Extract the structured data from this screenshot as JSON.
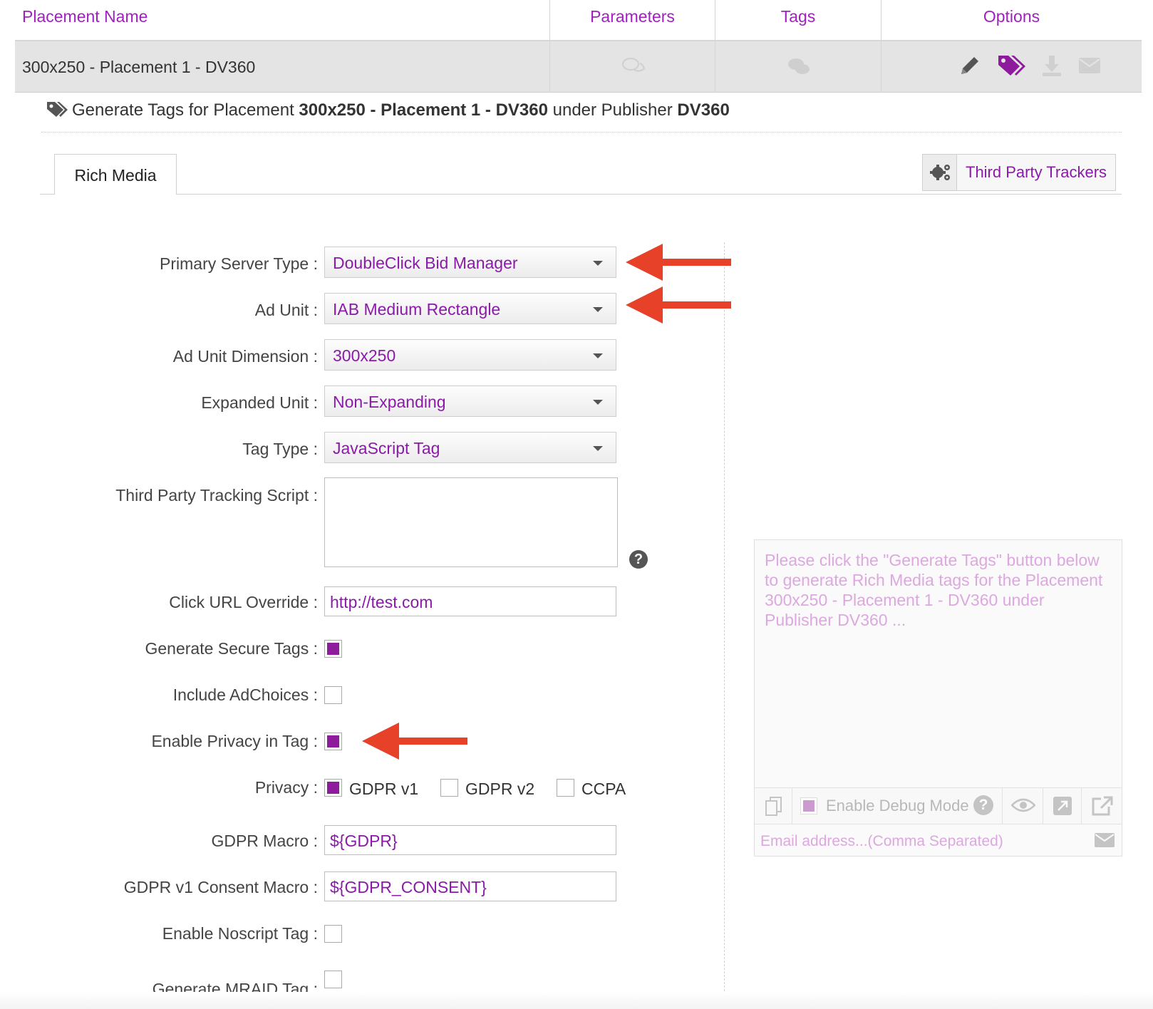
{
  "table": {
    "headers": {
      "placement_name": "Placement Name",
      "parameters": "Parameters",
      "tags": "Tags",
      "options": "Options"
    },
    "row": {
      "name": "300x250 - Placement 1 - DV360"
    }
  },
  "generate": {
    "prefix": "Generate Tags for Placement",
    "placement": "300x250 - Placement 1 - DV360",
    "middle": "under Publisher",
    "publisher": "DV360"
  },
  "tabs": {
    "rich_media": "Rich Media",
    "third_party_trackers": "Third Party Trackers"
  },
  "form": {
    "primary_server_type": {
      "label": "Primary Server Type :",
      "value": "DoubleClick Bid Manager"
    },
    "ad_unit": {
      "label": "Ad Unit :",
      "value": "IAB Medium Rectangle"
    },
    "ad_unit_dimension": {
      "label": "Ad Unit Dimension :",
      "value": "300x250"
    },
    "expanded_unit": {
      "label": "Expanded Unit :",
      "value": "Non-Expanding"
    },
    "tag_type": {
      "label": "Tag Type :",
      "value": "JavaScript Tag"
    },
    "third_party_tracking_script": {
      "label": "Third Party Tracking Script :",
      "value": ""
    },
    "click_url_override": {
      "label": "Click URL Override :",
      "value": "http://test.com"
    },
    "generate_secure_tags": {
      "label": "Generate Secure Tags :",
      "checked": true
    },
    "include_adchoices": {
      "label": "Include AdChoices :",
      "checked": false
    },
    "enable_privacy_in_tag": {
      "label": "Enable Privacy in Tag :",
      "checked": true
    },
    "privacy": {
      "label": "Privacy :",
      "options": [
        {
          "label": "GDPR v1",
          "checked": true
        },
        {
          "label": "GDPR v2",
          "checked": false
        },
        {
          "label": "CCPA",
          "checked": false
        }
      ]
    },
    "gdpr_macro": {
      "label": "GDPR Macro :",
      "value": "${GDPR}"
    },
    "gdpr_v1_consent_macro": {
      "label": "GDPR v1 Consent Macro :",
      "value": "${GDPR_CONSENT}"
    },
    "enable_noscript_tag": {
      "label": "Enable Noscript Tag :",
      "checked": false
    },
    "generate_mraid_tag": {
      "label": "Generate MRAID Tag :",
      "checked": false
    },
    "help_glyph": "?"
  },
  "output_panel": {
    "message": "Please click the \"Generate Tags\" button below to generate Rich Media tags for the Placement 300x250 - Placement 1 - DV360 under Publisher DV360 ...",
    "debug_label": "Enable Debug Mode",
    "debug_help": "?",
    "email_placeholder": "Email address...(Comma Separated)"
  },
  "icons": {
    "parameters": "comments-icon",
    "tags": "comments-filled-icon",
    "edit": "pencil-icon",
    "generate_tags": "tags-icon",
    "download": "download-icon",
    "email": "envelope-icon",
    "trackers": "gears-icon",
    "copy": "copy-icon",
    "preview": "eye-icon",
    "expand": "expand-icon",
    "open_external": "external-link-icon"
  },
  "colors": {
    "accent": "#a020c0",
    "checkbox": "#8e1a9c",
    "arrow": "#e8412a",
    "muted_accent": "#dca8df"
  }
}
